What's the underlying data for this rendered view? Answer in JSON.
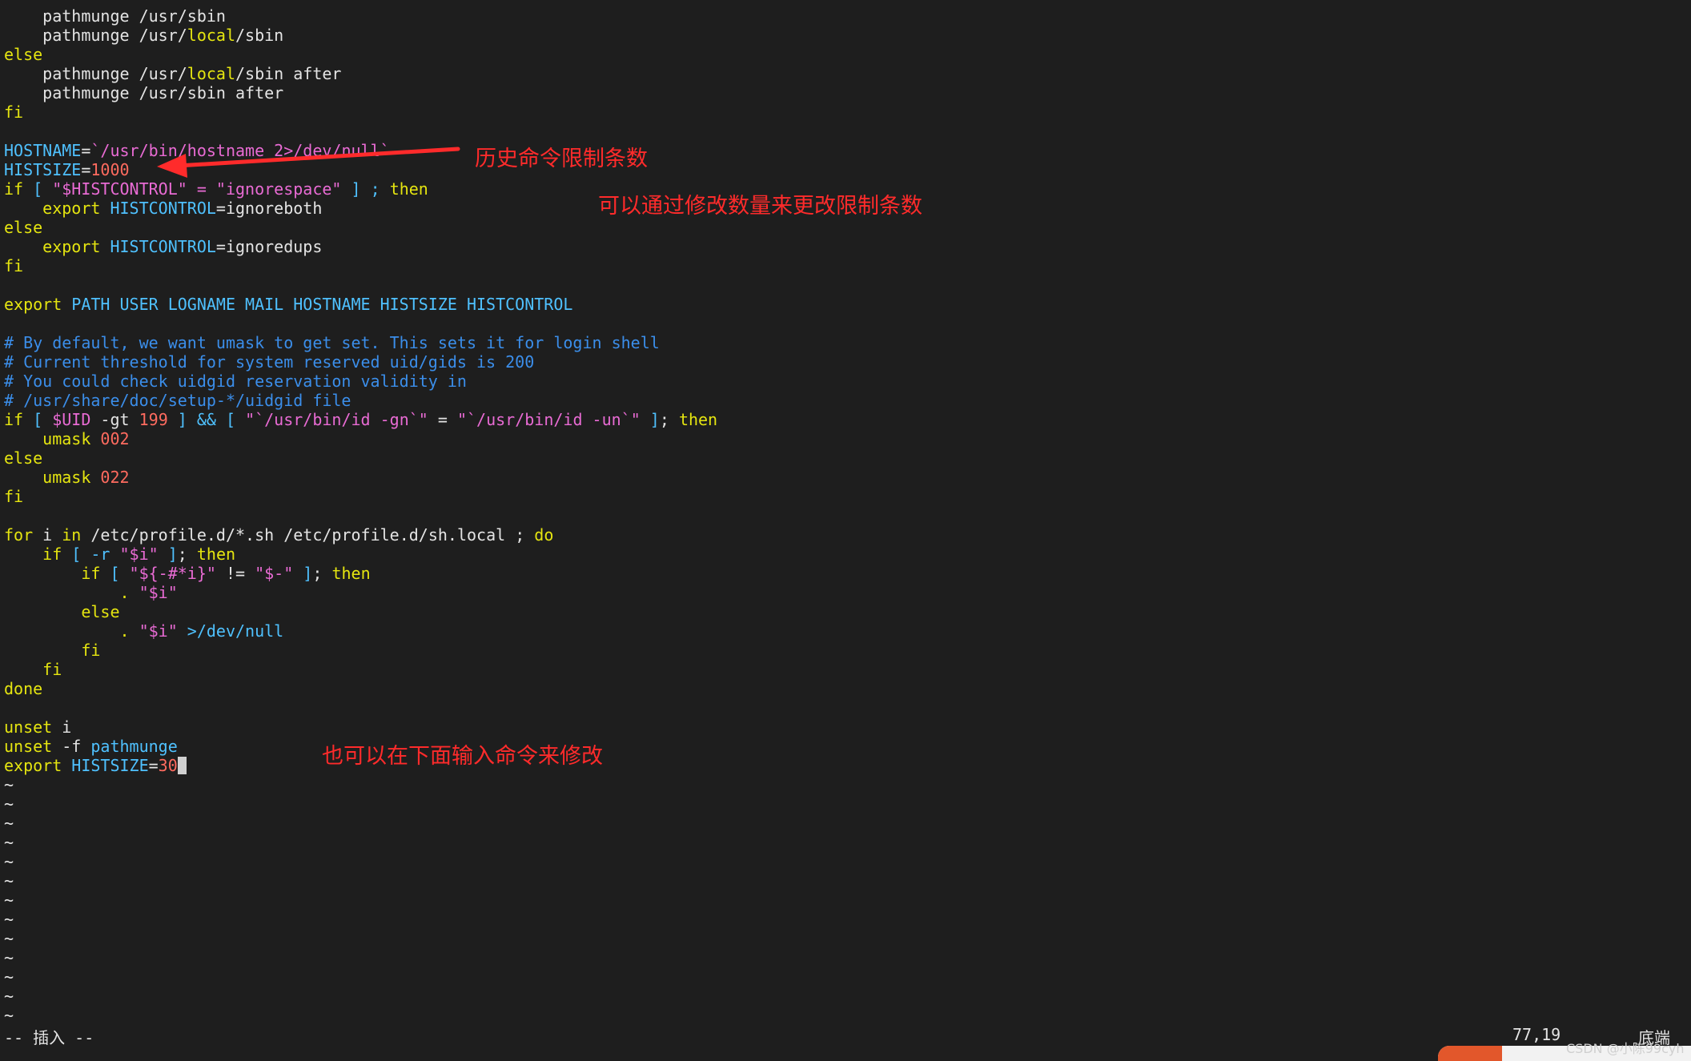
{
  "editor": {
    "lines": [
      [
        {
          "t": "    pathmunge /usr/sbin",
          "c": "plain"
        }
      ],
      [
        {
          "t": "    pathmunge /usr/",
          "c": "plain"
        },
        {
          "t": "local",
          "c": "kw"
        },
        {
          "t": "/sbin",
          "c": "plain"
        }
      ],
      [
        {
          "t": "else",
          "c": "kw"
        }
      ],
      [
        {
          "t": "    pathmunge /usr/",
          "c": "plain"
        },
        {
          "t": "local",
          "c": "kw"
        },
        {
          "t": "/sbin after",
          "c": "plain"
        }
      ],
      [
        {
          "t": "    pathmunge /usr/sbin after",
          "c": "plain"
        }
      ],
      [
        {
          "t": "fi",
          "c": "kw"
        }
      ],
      [],
      [
        {
          "t": "HOSTNAME",
          "c": "var"
        },
        {
          "t": "=",
          "c": "plain"
        },
        {
          "t": "`/usr/bin/hostname 2>/dev/null`",
          "c": "str"
        }
      ],
      [
        {
          "t": "HISTSIZE",
          "c": "var"
        },
        {
          "t": "=",
          "c": "plain"
        },
        {
          "t": "1000",
          "c": "num"
        }
      ],
      [
        {
          "t": "if",
          "c": "kw"
        },
        {
          "t": " [ ",
          "c": "cmd"
        },
        {
          "t": "\"",
          "c": "str"
        },
        {
          "t": "$HISTCONTROL",
          "c": "str"
        },
        {
          "t": "\" = \"ignorespace\"",
          "c": "str"
        },
        {
          "t": " ] ; ",
          "c": "cmd"
        },
        {
          "t": "then",
          "c": "kw"
        }
      ],
      [
        {
          "t": "    ",
          "c": "plain"
        },
        {
          "t": "export",
          "c": "kw"
        },
        {
          "t": " ",
          "c": "plain"
        },
        {
          "t": "HISTCONTROL",
          "c": "var"
        },
        {
          "t": "=ignoreboth",
          "c": "plain"
        }
      ],
      [
        {
          "t": "else",
          "c": "kw"
        }
      ],
      [
        {
          "t": "    ",
          "c": "plain"
        },
        {
          "t": "export",
          "c": "kw"
        },
        {
          "t": " ",
          "c": "plain"
        },
        {
          "t": "HISTCONTROL",
          "c": "var"
        },
        {
          "t": "=ignoredups",
          "c": "plain"
        }
      ],
      [
        {
          "t": "fi",
          "c": "kw"
        }
      ],
      [],
      [
        {
          "t": "export",
          "c": "kw"
        },
        {
          "t": " PATH USER LOGNAME MAIL HOSTNAME HISTSIZE HISTCONTROL",
          "c": "var"
        }
      ],
      [],
      [
        {
          "t": "# By default, we want umask to get set. This sets it for login shell",
          "c": "cmt"
        }
      ],
      [
        {
          "t": "# Current threshold for system reserved uid/gids is 200",
          "c": "cmt"
        }
      ],
      [
        {
          "t": "# You could check uidgid reservation validity in",
          "c": "cmt"
        }
      ],
      [
        {
          "t": "# /usr/share/doc/setup-*/uidgid file",
          "c": "cmt"
        }
      ],
      [
        {
          "t": "if",
          "c": "kw"
        },
        {
          "t": " [ ",
          "c": "cmd"
        },
        {
          "t": "$UID",
          "c": "str"
        },
        {
          "t": " -gt ",
          "c": "plain"
        },
        {
          "t": "199",
          "c": "num"
        },
        {
          "t": " ] && [ ",
          "c": "cmd"
        },
        {
          "t": "\"`/usr/bin/id -gn`\"",
          "c": "str"
        },
        {
          "t": " = ",
          "c": "plain"
        },
        {
          "t": "\"`/usr/bin/id -un`\"",
          "c": "str"
        },
        {
          "t": " ]",
          "c": "cmd"
        },
        {
          "t": "; ",
          "c": "plain"
        },
        {
          "t": "then",
          "c": "kw"
        }
      ],
      [
        {
          "t": "    umask ",
          "c": "kw"
        },
        {
          "t": "002",
          "c": "num"
        }
      ],
      [
        {
          "t": "else",
          "c": "kw"
        }
      ],
      [
        {
          "t": "    umask ",
          "c": "kw"
        },
        {
          "t": "022",
          "c": "num"
        }
      ],
      [
        {
          "t": "fi",
          "c": "kw"
        }
      ],
      [],
      [
        {
          "t": "for",
          "c": "kw"
        },
        {
          "t": " i ",
          "c": "plain"
        },
        {
          "t": "in",
          "c": "kw"
        },
        {
          "t": " /etc/profile.d/*.sh /etc/profile.d/sh.local ; ",
          "c": "plain"
        },
        {
          "t": "do",
          "c": "kw"
        }
      ],
      [
        {
          "t": "    ",
          "c": "plain"
        },
        {
          "t": "if",
          "c": "kw"
        },
        {
          "t": " [ -r ",
          "c": "cmd"
        },
        {
          "t": "\"$i\"",
          "c": "str"
        },
        {
          "t": " ]",
          "c": "cmd"
        },
        {
          "t": "; ",
          "c": "plain"
        },
        {
          "t": "then",
          "c": "kw"
        }
      ],
      [
        {
          "t": "        ",
          "c": "plain"
        },
        {
          "t": "if",
          "c": "kw"
        },
        {
          "t": " [ ",
          "c": "cmd"
        },
        {
          "t": "\"${-#*i}\"",
          "c": "str"
        },
        {
          "t": " != ",
          "c": "plain"
        },
        {
          "t": "\"$-\"",
          "c": "str"
        },
        {
          "t": " ]",
          "c": "cmd"
        },
        {
          "t": "; ",
          "c": "plain"
        },
        {
          "t": "then",
          "c": "kw"
        }
      ],
      [
        {
          "t": "            . ",
          "c": "kw"
        },
        {
          "t": "\"$i\"",
          "c": "str"
        }
      ],
      [
        {
          "t": "        else",
          "c": "kw"
        }
      ],
      [
        {
          "t": "            . ",
          "c": "kw"
        },
        {
          "t": "\"$i\"",
          "c": "str"
        },
        {
          "t": " >/dev/null",
          "c": "cmd"
        }
      ],
      [
        {
          "t": "        fi",
          "c": "kw"
        }
      ],
      [
        {
          "t": "    fi",
          "c": "kw"
        }
      ],
      [
        {
          "t": "done",
          "c": "kw"
        }
      ],
      [],
      [
        {
          "t": "unset",
          "c": "kw"
        },
        {
          "t": " i",
          "c": "plain"
        }
      ],
      [
        {
          "t": "unset",
          "c": "kw"
        },
        {
          "t": " -f ",
          "c": "plain"
        },
        {
          "t": "pathmunge",
          "c": "var"
        }
      ],
      [
        {
          "t": "export",
          "c": "kw"
        },
        {
          "t": " HISTSIZE",
          "c": "var"
        },
        {
          "t": "=",
          "c": "plain"
        },
        {
          "t": "30",
          "c": "num"
        },
        {
          "t": "",
          "c": "cursor"
        }
      ],
      [
        {
          "t": "~",
          "c": "tilde"
        }
      ],
      [
        {
          "t": "~",
          "c": "tilde"
        }
      ],
      [
        {
          "t": "~",
          "c": "tilde"
        }
      ],
      [
        {
          "t": "~",
          "c": "tilde"
        }
      ],
      [
        {
          "t": "~",
          "c": "tilde"
        }
      ],
      [
        {
          "t": "~",
          "c": "tilde"
        }
      ],
      [
        {
          "t": "~",
          "c": "tilde"
        }
      ],
      [
        {
          "t": "~",
          "c": "tilde"
        }
      ],
      [
        {
          "t": "~",
          "c": "tilde"
        }
      ],
      [
        {
          "t": "~",
          "c": "tilde"
        }
      ],
      [
        {
          "t": "~",
          "c": "tilde"
        }
      ],
      [
        {
          "t": "~",
          "c": "tilde"
        }
      ],
      [
        {
          "t": "~",
          "c": "tilde"
        }
      ]
    ]
  },
  "statusbar": {
    "mode": "-- 插入 --",
    "position": "77,19",
    "place": "底端"
  },
  "annotations": {
    "note1": "历史命令限制条数",
    "note2": "可以通过修改数量来更改限制条数",
    "note3": "也可以在下面输入命令来修改"
  },
  "watermark": "CSDN @小陈99cyh",
  "colors": {
    "background": "#1e1e1e",
    "keyword": "#e5e510",
    "variable": "#4fc1ff",
    "string": "#e96bd4",
    "number": "#ff6b5f",
    "comment": "#3b8eea",
    "annotation": "#ff2b2b"
  }
}
